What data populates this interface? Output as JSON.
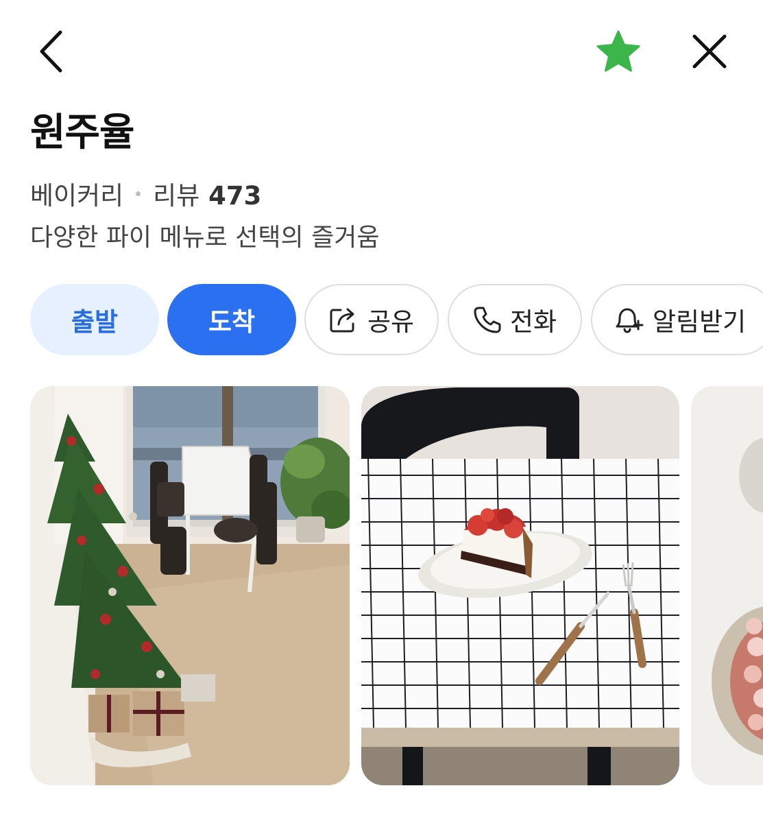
{
  "header": {
    "back_icon": "chevron-left-icon",
    "favorite_icon": "star-icon",
    "close_icon": "close-icon",
    "favorite_color": "#3cb54a"
  },
  "place": {
    "name": "원주율",
    "category": "베이커리",
    "review_label": "리뷰",
    "review_count": "473",
    "description": "다양한 파이 메뉴로 선택의 즐거움"
  },
  "actions": [
    {
      "label": "출발",
      "icon": null
    },
    {
      "label": "도착",
      "icon": null
    },
    {
      "label": "공유",
      "icon": "share-icon"
    },
    {
      "label": "전화",
      "icon": "phone-icon"
    },
    {
      "label": "알림받기",
      "icon": "bell-plus-icon"
    }
  ],
  "colors": {
    "accent": "#2a70f0",
    "accent_light": "#e6f0ff",
    "accent_text": "#2a6ddf"
  },
  "photos": [
    {
      "subject": "cafe-interior-with-christmas-tree"
    },
    {
      "subject": "strawberry-pie-slice-on-tiled-table"
    },
    {
      "subject": "strawberry-tart-partial"
    }
  ]
}
